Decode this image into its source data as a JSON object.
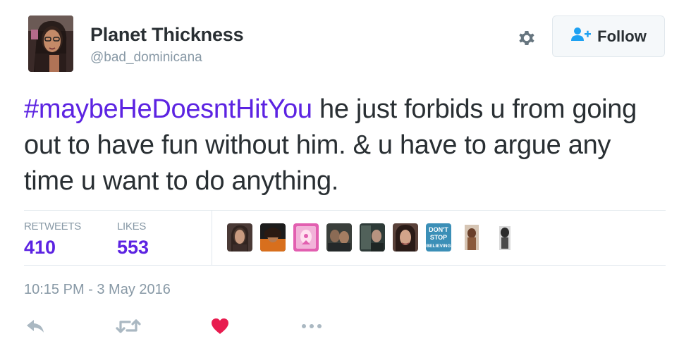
{
  "author": {
    "name": "Planet Thickness",
    "handle": "@bad_dominicana"
  },
  "actions_top": {
    "follow_label": "Follow",
    "gear_icon": "gear-icon",
    "follow_icon": "add-user-icon"
  },
  "tweet": {
    "hashtag": "#maybeHeDoesntHitYou",
    "body": " he just forbids u from going out to have fun without him. & u have to argue any time u want to do anything."
  },
  "stats": {
    "retweets_label": "RETWEETS",
    "retweets_count": "410",
    "likes_label": "LIKES",
    "likes_count": "553"
  },
  "likers": [
    {
      "name": "liker-avatar-1"
    },
    {
      "name": "liker-avatar-2"
    },
    {
      "name": "liker-avatar-3"
    },
    {
      "name": "liker-avatar-4"
    },
    {
      "name": "liker-avatar-5"
    },
    {
      "name": "liker-avatar-6"
    },
    {
      "name": "liker-avatar-7",
      "text": "DON'T STOP BELIEVING"
    },
    {
      "name": "liker-avatar-8"
    },
    {
      "name": "liker-avatar-9"
    }
  ],
  "timestamp": "10:15 PM - 3 May 2016",
  "actions_bottom": [
    "reply-icon",
    "retweet-icon",
    "heart-icon",
    "more-icon"
  ],
  "colors": {
    "accent": "#5c23e2",
    "muted": "#8899a6",
    "heart": "#e81c4f",
    "text": "#292f33"
  }
}
